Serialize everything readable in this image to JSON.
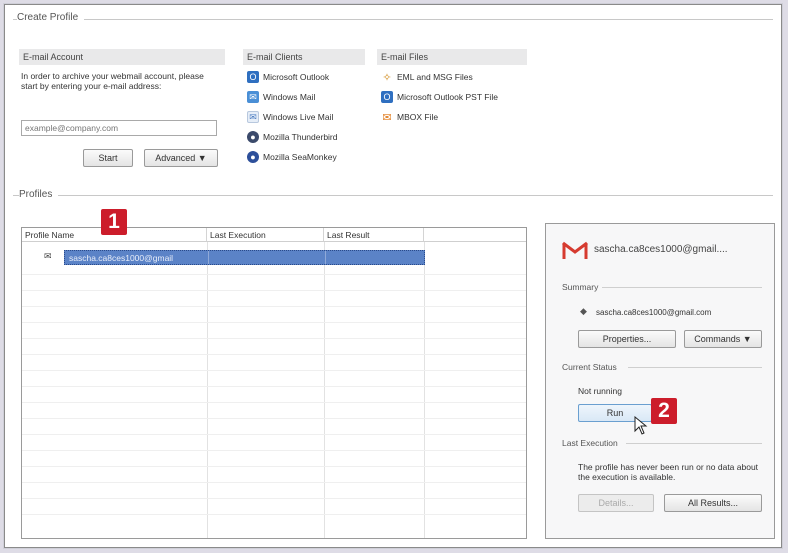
{
  "create_profile": {
    "title": "Create Profile",
    "email_account": {
      "header": "E-mail Account",
      "description": "In order to archive your webmail account, please start by entering your e-mail address:",
      "input_placeholder": "example@company.com",
      "start_label": "Start",
      "advanced_label": "Advanced ▼"
    },
    "email_clients": {
      "header": "E-mail Clients",
      "items": [
        {
          "label": "Microsoft Outlook",
          "icon": "outlook-icon"
        },
        {
          "label": "Windows Mail",
          "icon": "windows-mail-icon"
        },
        {
          "label": "Windows Live Mail",
          "icon": "windows-live-mail-icon"
        },
        {
          "label": "Mozilla Thunderbird",
          "icon": "thunderbird-icon"
        },
        {
          "label": "Mozilla SeaMonkey",
          "icon": "seamonkey-icon"
        }
      ]
    },
    "email_files": {
      "header": "E-mail Files",
      "items": [
        {
          "label": "EML and MSG Files",
          "icon": "eml-msg-icon"
        },
        {
          "label": "Microsoft Outlook PST File",
          "icon": "pst-file-icon"
        },
        {
          "label": "MBOX File",
          "icon": "mbox-file-icon"
        }
      ]
    }
  },
  "profiles": {
    "title": "Profiles",
    "columns": [
      "Profile Name",
      "Last Execution",
      "Last Result"
    ],
    "selected_row": {
      "name": "sascha.ca8ces1000@gmail",
      "last_execution": "",
      "last_result": ""
    }
  },
  "side_panel": {
    "account_label": "sascha.ca8ces1000@gmail....",
    "summary_title": "Summary",
    "summary_email": "sascha.ca8ces1000@gmail.com",
    "properties_label": "Properties...",
    "commands_label": "Commands ▼",
    "current_status_title": "Current Status",
    "status_text": "Not running",
    "run_label": "Run",
    "last_execution_title": "Last Execution",
    "last_execution_text": "The profile has never been run or no data about the execution is available.",
    "details_label": "Details...",
    "all_results_label": "All Results..."
  },
  "callouts": {
    "one": "1",
    "two": "2"
  },
  "colors": {
    "selection": "#5b83c7",
    "gmail_red": "#d63b30",
    "callout_red": "#cc1d2b"
  }
}
